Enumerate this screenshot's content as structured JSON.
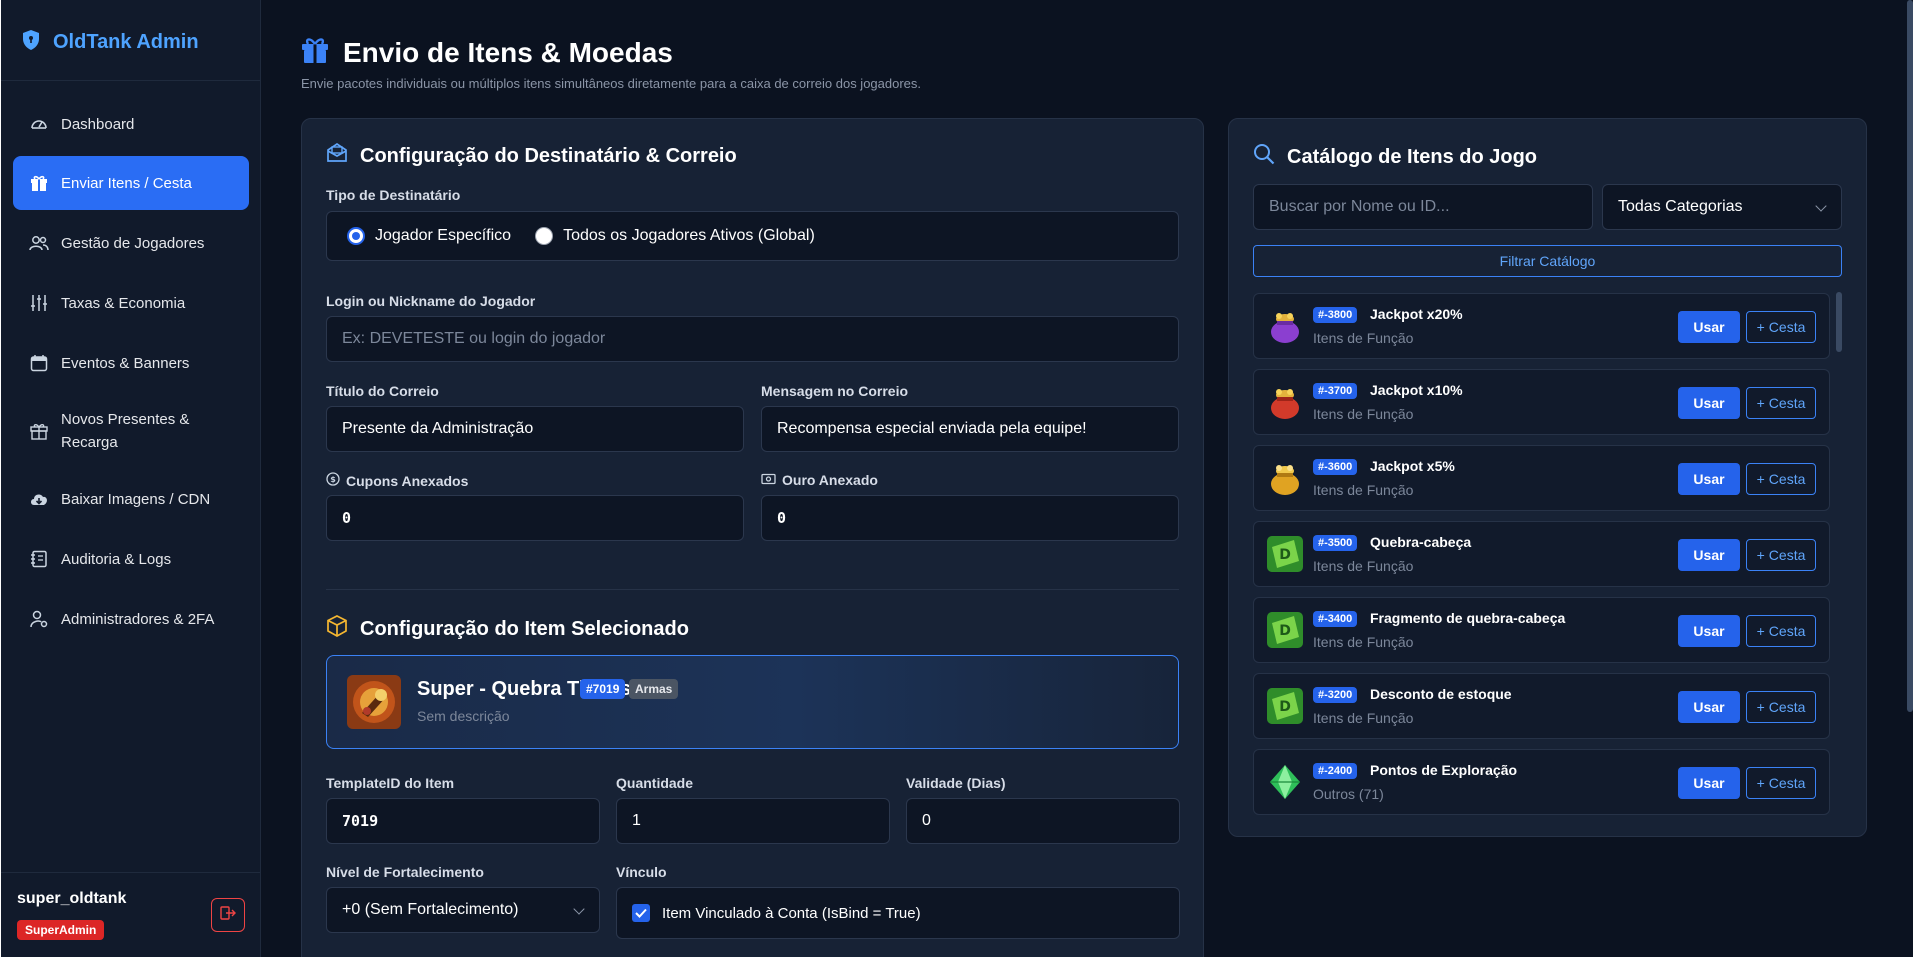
{
  "app": {
    "brand": "OldTank Admin"
  },
  "sidebar": {
    "items": [
      {
        "label": "Dashboard",
        "icon": "gauge-icon"
      },
      {
        "label": "Enviar Itens / Cesta",
        "icon": "gift-icon",
        "active": true
      },
      {
        "label": "Gestão de Jogadores",
        "icon": "users-icon"
      },
      {
        "label": "Taxas & Economia",
        "icon": "sliders-icon"
      },
      {
        "label": "Eventos & Banners",
        "icon": "calendar-icon"
      },
      {
        "label": "Novos Presentes & Recarga",
        "icon": "gift-icon"
      },
      {
        "label": "Baixar Imagens / CDN",
        "icon": "cloud-download-icon"
      },
      {
        "label": "Auditoria & Logs",
        "icon": "journal-icon"
      },
      {
        "label": "Administradores & 2FA",
        "icon": "user-gear-icon"
      }
    ],
    "user": {
      "name": "super_oldtank",
      "role": "SuperAdmin"
    }
  },
  "header": {
    "title": "Envio de Itens & Moedas",
    "subtitle": "Envie pacotes individuais ou múltiplos itens simultâneos diretamente para a caixa de correio dos jogadores."
  },
  "mail_config": {
    "title": "Configuração do Destinatário & Correio",
    "recipient_type_label": "Tipo de Destinatário",
    "radio_specific": "Jogador Específico",
    "radio_global": "Todos os Jogadores Ativos (Global)",
    "login_label": "Login ou Nickname do Jogador",
    "login_placeholder": "Ex: DEVETESTE ou login do jogador",
    "mail_title_label": "Título do Correio",
    "mail_title_value": "Presente da Administração",
    "mail_message_label": "Mensagem no Correio",
    "mail_message_value": "Recompensa especial enviada pela equipe!",
    "coupons_label": "Cupons Anexados",
    "coupons_value": "0",
    "gold_label": "Ouro Anexado",
    "gold_value": "0"
  },
  "item_config": {
    "title": "Configuração do Item Selecionado",
    "selected": {
      "name": "Super - Quebra Tijolos",
      "id": "#7019",
      "category": "Armas",
      "description": "Sem descrição"
    },
    "template_label": "TemplateID do Item",
    "template_value": "7019",
    "quantity_label": "Quantidade",
    "quantity_value": "1",
    "validity_label": "Validade (Dias)",
    "validity_value": "0",
    "strength_label": "Nível de Fortalecimento",
    "strength_value": "+0 (Sem Fortalecimento)",
    "bind_label": "Vínculo",
    "bind_checkbox": "Item Vinculado à Conta (IsBind = True)"
  },
  "catalog": {
    "title": "Catálogo de Itens do Jogo",
    "search_placeholder": "Buscar por Nome ou ID...",
    "category_select": "Todas Categorias",
    "filter_button": "Filtrar Catálogo",
    "use_label": "Usar",
    "basket_label": "Cesta",
    "items": [
      {
        "id": "#-3800",
        "name": "Jackpot x20%",
        "category": "Itens de Função",
        "icon": "purple-bag-icon"
      },
      {
        "id": "#-3700",
        "name": "Jackpot x10%",
        "category": "Itens de Função",
        "icon": "red-bag-icon"
      },
      {
        "id": "#-3600",
        "name": "Jackpot x5%",
        "category": "Itens de Função",
        "icon": "gold-bag-icon"
      },
      {
        "id": "#-3500",
        "name": "Quebra-cabeça",
        "category": "Itens de Função",
        "icon": "green-ticket-icon"
      },
      {
        "id": "#-3400",
        "name": "Fragmento de quebra-cabeça",
        "category": "Itens de Função",
        "icon": "green-ticket-icon"
      },
      {
        "id": "#-3200",
        "name": "Desconto de estoque",
        "category": "Itens de Função",
        "icon": "green-ticket-icon"
      },
      {
        "id": "#-2400",
        "name": "Pontos de Exploração",
        "category": "Outros (71)",
        "icon": "green-gem-icon"
      }
    ]
  },
  "colors": {
    "accent": "#2563eb",
    "brand": "#4ea3ff",
    "danger": "#dc2626",
    "background": "#0b1220",
    "panel": "#172235"
  }
}
